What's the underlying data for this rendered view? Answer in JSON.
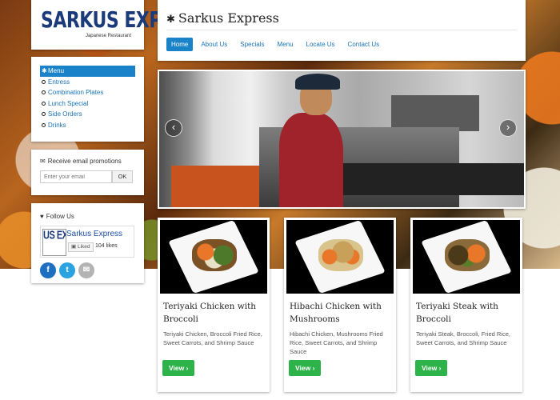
{
  "brand": {
    "logo_text": "SARKUS EXPRESS",
    "logo_subtitle": "Japanese Restaurant"
  },
  "header": {
    "title": "Sarkus Express",
    "nav": [
      {
        "label": "Home",
        "active": true
      },
      {
        "label": "About Us",
        "active": false
      },
      {
        "label": "Specials",
        "active": false
      },
      {
        "label": "Menu",
        "active": false
      },
      {
        "label": "Locate Us",
        "active": false
      },
      {
        "label": "Contact Us",
        "active": false
      }
    ]
  },
  "sidebar": {
    "menu": [
      {
        "label": "Menu",
        "active": true
      },
      {
        "label": "Entress",
        "active": false
      },
      {
        "label": "Combination Plates",
        "active": false
      },
      {
        "label": "Lunch Special",
        "active": false
      },
      {
        "label": "Side Orders",
        "active": false
      },
      {
        "label": "Drinks",
        "active": false
      }
    ],
    "email": {
      "heading": "Receive email promotions",
      "placeholder": "Enter your email",
      "button": "OK"
    },
    "follow": {
      "heading": "Follow Us",
      "page_name": "Sarkus Express",
      "thumb_text": "US EX",
      "liked_label": "Liked",
      "likes": "104 likes",
      "social": [
        {
          "icon": "facebook-icon",
          "glyph": "f"
        },
        {
          "icon": "twitter-icon",
          "glyph": "t"
        },
        {
          "icon": "email-icon",
          "glyph": "✉"
        }
      ]
    }
  },
  "slider": {
    "prev_glyph": "‹",
    "next_glyph": "›"
  },
  "cards": [
    {
      "title": "Teriyaki Chicken with Broccoli",
      "description": "Teriyaki Chicken, Broccoli Fried Rice, Sweet Carrots, and Shrimp Sauce",
      "button": "View ›"
    },
    {
      "title": "Hibachi Chicken with Mushrooms",
      "description": "Hibachi Chicken, Mushrooms Fried Rice, Sweet Carrots, and Shrimp Sauce",
      "button": "View ›"
    },
    {
      "title": "Teriyaki Steak with Broccoli",
      "description": "Teriyaki Steak, Broccoli, Fried Rice, Sweet Carrots, and Shrimp Sauce",
      "button": "View ›"
    }
  ],
  "colors": {
    "accent": "#1a82c8",
    "link": "#1a74b8",
    "view_button": "#2db34a",
    "logo": "#1b3a7a"
  }
}
